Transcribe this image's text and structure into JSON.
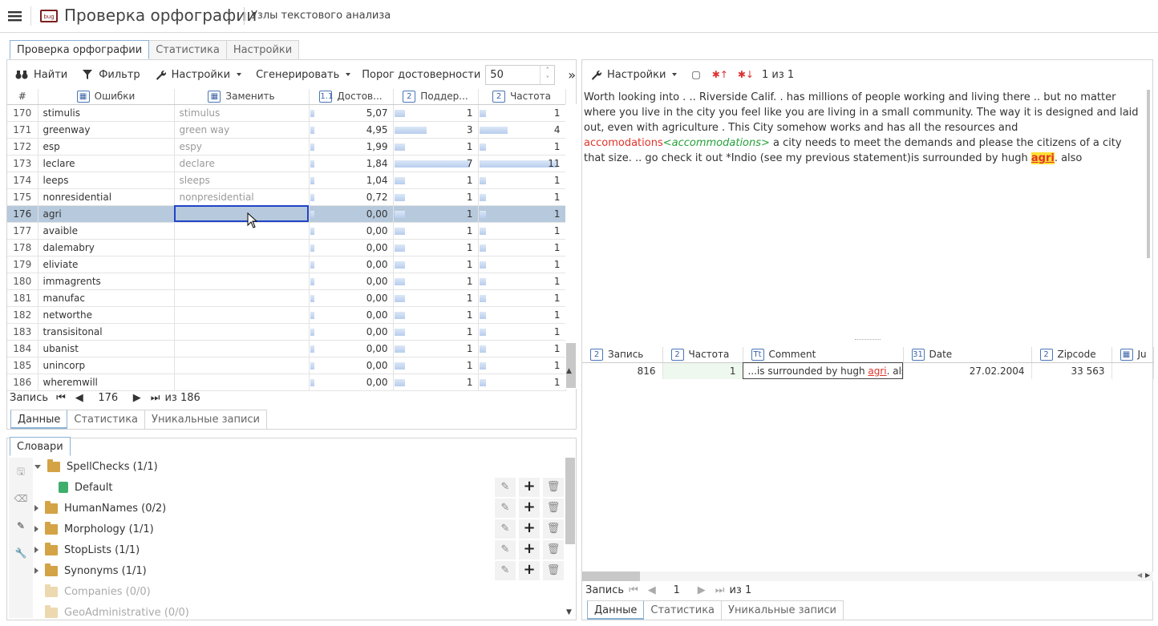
{
  "header": {
    "app_title": "Проверка орфографии",
    "subtitle": "Узлы текстового анализа",
    "logo_text": "bug"
  },
  "left": {
    "tabs": [
      "Проверка орфографии",
      "Статистика",
      "Настройки"
    ],
    "toolbar": {
      "find": "Найти",
      "filter": "Фильтр",
      "settings": "Настройки",
      "generate": "Сгенерировать",
      "threshold_label": "Порог достоверности",
      "threshold_value": "50"
    },
    "grid": {
      "columns": [
        "#",
        "Ошибки",
        "Заменить",
        "Достов...",
        "Поддер...",
        "Частота"
      ],
      "rows": [
        {
          "n": "170",
          "err": "stimulis",
          "rep": "stimulus",
          "conf": "5,07",
          "sup": "1",
          "freq": "1"
        },
        {
          "n": "171",
          "err": "greenway",
          "rep": "green way",
          "conf": "4,95",
          "sup": "3",
          "freq": "4"
        },
        {
          "n": "172",
          "err": "esp",
          "rep": "espy",
          "conf": "1,99",
          "sup": "1",
          "freq": "1"
        },
        {
          "n": "173",
          "err": "leclare",
          "rep": "declare",
          "conf": "1,84",
          "sup": "7",
          "freq": "11"
        },
        {
          "n": "174",
          "err": "leeps",
          "rep": "sleeps",
          "conf": "1,04",
          "sup": "1",
          "freq": "1"
        },
        {
          "n": "175",
          "err": "nonresidential",
          "rep": "nonpresidential",
          "conf": "0,72",
          "sup": "1",
          "freq": "1"
        },
        {
          "n": "176",
          "err": "agri",
          "rep": "",
          "conf": "0,00",
          "sup": "1",
          "freq": "1"
        },
        {
          "n": "177",
          "err": "avaible",
          "rep": "",
          "conf": "0,00",
          "sup": "1",
          "freq": "1"
        },
        {
          "n": "178",
          "err": "dalemabry",
          "rep": "",
          "conf": "0,00",
          "sup": "1",
          "freq": "1"
        },
        {
          "n": "179",
          "err": "eliviate",
          "rep": "",
          "conf": "0,00",
          "sup": "1",
          "freq": "1"
        },
        {
          "n": "180",
          "err": "immagrents",
          "rep": "",
          "conf": "0,00",
          "sup": "1",
          "freq": "1"
        },
        {
          "n": "181",
          "err": "manufac",
          "rep": "",
          "conf": "0,00",
          "sup": "1",
          "freq": "1"
        },
        {
          "n": "182",
          "err": "networthe",
          "rep": "",
          "conf": "0,00",
          "sup": "1",
          "freq": "1"
        },
        {
          "n": "183",
          "err": "transisitonal",
          "rep": "",
          "conf": "0,00",
          "sup": "1",
          "freq": "1"
        },
        {
          "n": "184",
          "err": "ubanist",
          "rep": "",
          "conf": "0,00",
          "sup": "1",
          "freq": "1"
        },
        {
          "n": "185",
          "err": "unincorp",
          "rep": "",
          "conf": "0,00",
          "sup": "1",
          "freq": "1"
        },
        {
          "n": "186",
          "err": "wheremwill",
          "rep": "",
          "conf": "0,00",
          "sup": "1",
          "freq": "1"
        }
      ]
    },
    "nav": {
      "label": "Запись",
      "current": "176",
      "total": "из 186"
    },
    "bottom_tabs": [
      "Данные",
      "Статистика",
      "Уникальные записи"
    ]
  },
  "dicts": {
    "tab": "Словари",
    "items": [
      {
        "name": "SpellChecks (1/1)",
        "expanded": true,
        "dim": false
      },
      {
        "name": "Default",
        "child": true,
        "dim": false
      },
      {
        "name": "HumanNames (0/2)",
        "dim": false
      },
      {
        "name": "Morphology (1/1)",
        "dim": false
      },
      {
        "name": "StopLists (1/1)",
        "dim": false
      },
      {
        "name": "Synonyms (1/1)",
        "dim": false
      },
      {
        "name": "Companies (0/0)",
        "dim": true
      },
      {
        "name": "GeoAdministrative (0/0)",
        "dim": true
      }
    ]
  },
  "right": {
    "toolbar": {
      "settings": "Настройки",
      "counter": "1 из 1"
    },
    "text": {
      "part1": "Worth looking into . .. Riverside Calif. . has millions of people working and living there .. but no matter where you live in the city you feel like you are living in a small community. The way it is designed and laid out, even with agriculture . This City somehow works and has all the resources and ",
      "wrong": "accomodations",
      "correction": "<accommodations>",
      "part2": " a city needs to meet the demands and please the citizens of a city that size. .. go check it out *Indio (see my previous statement)is surrounded by hugh ",
      "marked": "agri",
      "part3": ". also"
    },
    "grid": {
      "columns": [
        "Запись",
        "Частота",
        "Comment",
        "Date",
        "Zipcode",
        "Ju"
      ],
      "row": {
        "rec": "816",
        "freq": "1",
        "comment_pre": "...is surrounded by hugh ",
        "comment_mark": "agri",
        "comment_post": ". also",
        "date": "27.02.2004",
        "zip": "33 563"
      }
    },
    "nav": {
      "label": "Запись",
      "current": "1",
      "total": "из 1"
    },
    "bottom_tabs": [
      "Данные",
      "Статистика",
      "Уникальные записи"
    ]
  }
}
